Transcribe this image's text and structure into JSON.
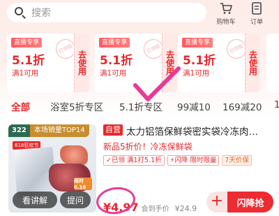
{
  "search": {
    "placeholder": "搜索"
  },
  "header": {
    "cart_label": "购物车",
    "order_label": "订单"
  },
  "coupons": [
    {
      "tag": "直播专享",
      "value": "5.1折",
      "condition": "满1可用",
      "stamp": "已领取",
      "action": "去使用"
    },
    {
      "tag": "直播专享",
      "value": "5.1折",
      "condition": "满1可用",
      "stamp": "已领取",
      "action": "去使用"
    },
    {
      "tag": "直播专享",
      "value": "5.1折",
      "condition": "满1可用",
      "stamp": "已领取",
      "action": "去使用"
    }
  ],
  "tabs": [
    {
      "label": "全部",
      "active": true
    },
    {
      "label": "浴室5折专区"
    },
    {
      "label": "5.1折专区"
    },
    {
      "label": "99减10"
    },
    {
      "label": "169减20"
    },
    {
      "label": "1"
    }
  ],
  "product": {
    "rank_num": "322",
    "rank_text": "本场销量TOP14",
    "thumb_promo": "618狂欢节",
    "sale_badge": "限时6.18",
    "explain_label": "看讲解",
    "ask_label": "提问",
    "self_tag": "自营",
    "title": "太力铝箔保鲜袋密实袋冷冻肉…",
    "subtitle": "新品5折价！冷冻保鲜袋",
    "badges": [
      "✓已领 满1打5.1折",
      "⚡闪降 限时限量",
      "7天价保"
    ],
    "price": "¥4.97",
    "price_note": "会到手价",
    "orig_price": "¥24.9",
    "cta_label": "闪降抢",
    "plus": "+"
  },
  "colors": {
    "accent": "#e8282c",
    "highlight": "#e83a94"
  }
}
